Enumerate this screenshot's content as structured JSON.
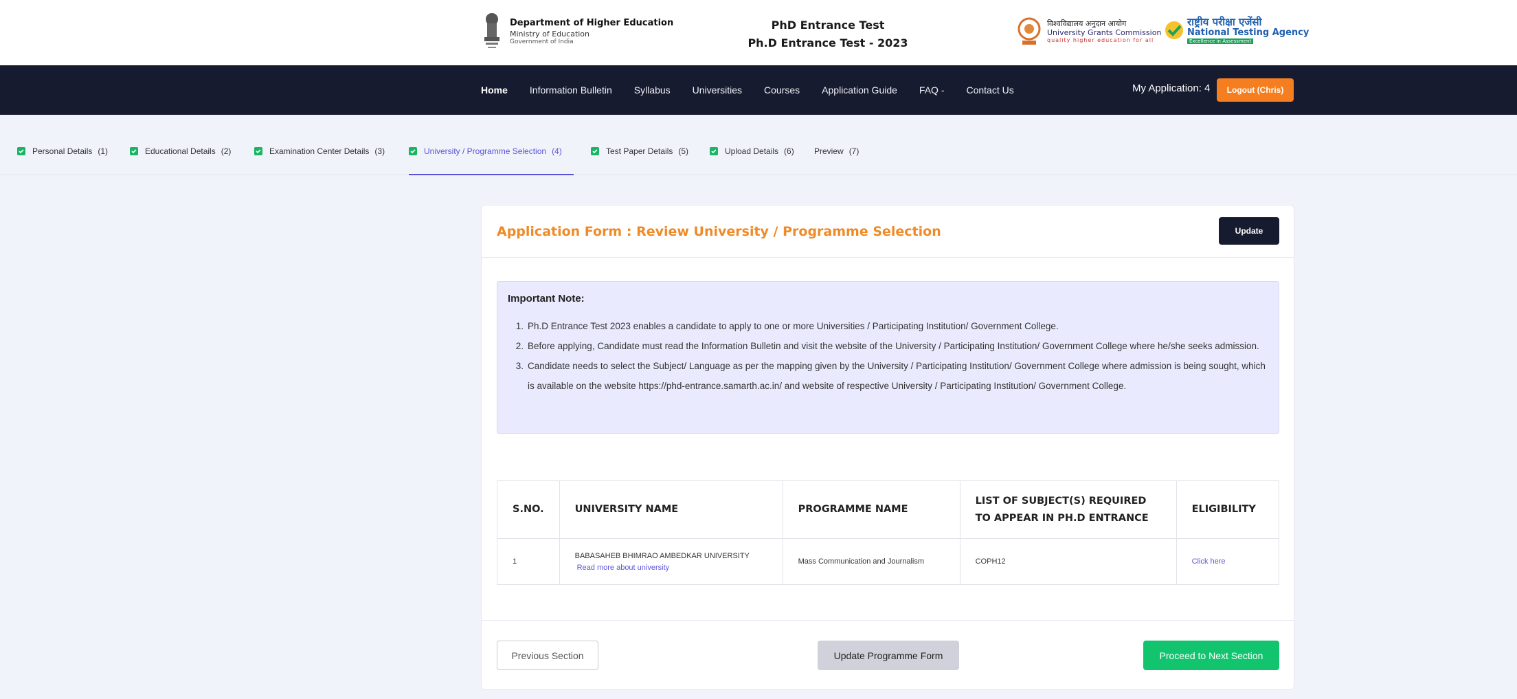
{
  "header": {
    "dhe_title": "Department of Higher Education",
    "dhe_ministry": "Ministry of Education",
    "dhe_gov": "Government of India",
    "title_line1": "PhD Entrance Test",
    "title_line2": "Ph.D Entrance Test - 2023",
    "ugc_hindi": "विश्वविद्यालय अनुदान आयोग",
    "ugc_name": "University Grants Commission",
    "ugc_tagline": "quality higher education for all",
    "nta_hindi": "राष्ट्रीय परीक्षा एजेंसी",
    "nta_name": "National Testing Agency",
    "nta_tagline": "Excellence in Assessment"
  },
  "nav": {
    "links": [
      "Home",
      "Information Bulletin",
      "Syllabus",
      "Universities",
      "Courses",
      "Application Guide",
      "FAQ -",
      "Contact Us"
    ],
    "my_application": "My Application: 4",
    "logout": "Logout (Chris)"
  },
  "steps": [
    {
      "label": "Personal Details",
      "num": "(1)"
    },
    {
      "label": "Educational Details",
      "num": "(2)"
    },
    {
      "label": "Examination Center Details",
      "num": "(3)"
    },
    {
      "label": "University / Programme Selection",
      "num": "(4)"
    },
    {
      "label": "Test Paper Details",
      "num": "(5)"
    },
    {
      "label": "Upload Details",
      "num": "(6)"
    },
    {
      "label": "Preview",
      "num": "(7)"
    }
  ],
  "card": {
    "title": "Application Form : Review University / Programme Selection",
    "update": "Update"
  },
  "note": {
    "title": "Important Note:",
    "items": [
      "Ph.D Entrance Test 2023 enables a candidate to apply to one or more Universities / Participating Institution/ Government College.",
      "Before applying, Candidate must read the Information Bulletin and visit the website of the University / Participating Institution/ Government College where he/she seeks admission.",
      "Candidate needs to select the Subject/ Language as per the mapping given by the University / Participating Institution/ Government College where admission is being sought, which is available on the website https://phd-entrance.samarth.ac.in/ and website of respective University / Participating Institution/ Government College."
    ]
  },
  "table": {
    "headers": [
      "S.NO.",
      "UNIVERSITY NAME",
      "PROGRAMME NAME",
      "LIST OF SUBJECT(S) REQUIRED TO APPEAR IN PH.D ENTRANCE",
      "ELIGIBILITY"
    ],
    "rows": [
      {
        "sno": "1",
        "university": "BABASAHEB BHIMRAO AMBEDKAR UNIVERSITY",
        "read_more": "Read more about university",
        "programme": "Mass Communication and Journalism",
        "subjects": "COPH12",
        "eligibility": "Click here"
      }
    ]
  },
  "footer": {
    "previous": "Previous Section",
    "update_programme": "Update Programme Form",
    "next": "Proceed to Next Section"
  }
}
